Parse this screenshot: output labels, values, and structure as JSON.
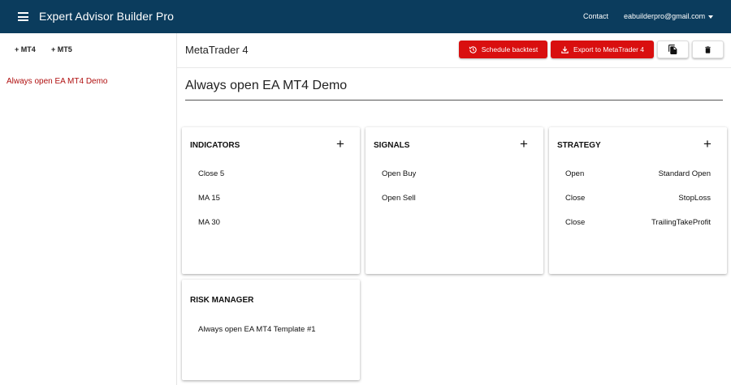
{
  "app": {
    "title": "Expert Advisor Builder Pro"
  },
  "header": {
    "contact": "Contact",
    "account": "eabuilderpro@gmail.com"
  },
  "sidebar": {
    "tabs": [
      "+ MT4",
      "+ MT5"
    ],
    "items": [
      {
        "label": "Always open EA MT4 Demo",
        "color": "#b01010"
      }
    ]
  },
  "toolbar": {
    "platform_title": "MetaTrader 4",
    "schedule_label": "Schedule backtest",
    "export_label": "Export to MetaTrader 4"
  },
  "ea": {
    "name": "Always open EA MT4 Demo"
  },
  "cards": {
    "indicators": {
      "title": "INDICATORS",
      "add": "+",
      "items": [
        "Close 5",
        "MA 15",
        "MA 30"
      ]
    },
    "signals": {
      "title": "SIGNALS",
      "add": "+",
      "items": [
        "Open Buy",
        "Open Sell"
      ]
    },
    "strategy": {
      "title": "STRATEGY",
      "add": "+",
      "rows": [
        {
          "action": "Open",
          "rule": "Standard Open"
        },
        {
          "action": "Close",
          "rule": "StopLoss"
        },
        {
          "action": "Close",
          "rule": "TrailingTakeProfit"
        }
      ]
    },
    "risk": {
      "title": "RISK MANAGER",
      "items": [
        "Always open EA MT4 Template #1"
      ]
    }
  },
  "colors": {
    "appbar": "#0b3c5d",
    "accent_red": "#d90f0f",
    "link_red": "#b01010"
  },
  "icons": [
    "menu-icon",
    "dropdown-caret-icon",
    "history-icon",
    "download-icon",
    "copy-icon",
    "trash-icon"
  ]
}
